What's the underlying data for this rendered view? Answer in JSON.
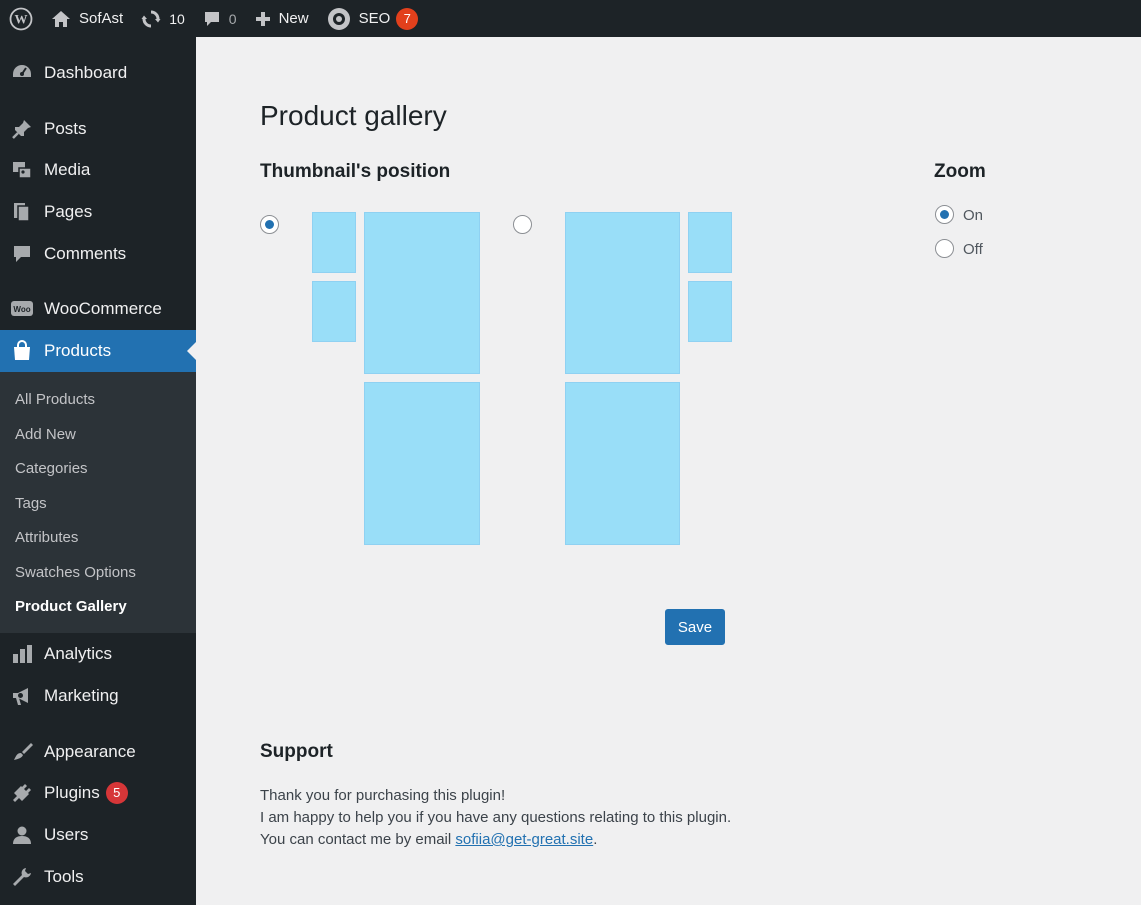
{
  "adminbar": {
    "site_name": "SofAst",
    "updates_count": "10",
    "comments_count": "0",
    "new_label": "New",
    "seo_label": "SEO",
    "seo_badge": "7"
  },
  "sidebar": {
    "items": [
      {
        "label": "Dashboard",
        "icon": "dashboard-icon"
      },
      {
        "label": "Posts",
        "icon": "pin-icon"
      },
      {
        "label": "Media",
        "icon": "media-icon"
      },
      {
        "label": "Pages",
        "icon": "pages-icon"
      },
      {
        "label": "Comments",
        "icon": "comment-icon"
      },
      {
        "label": "WooCommerce",
        "icon": "woo-icon"
      },
      {
        "label": "Products",
        "icon": "bag-icon"
      },
      {
        "label": "Analytics",
        "icon": "bar-chart-icon"
      },
      {
        "label": "Marketing",
        "icon": "megaphone-icon"
      },
      {
        "label": "Appearance",
        "icon": "brush-icon"
      },
      {
        "label": "Plugins",
        "icon": "plug-icon",
        "badge": "5"
      },
      {
        "label": "Users",
        "icon": "user-icon"
      },
      {
        "label": "Tools",
        "icon": "wrench-icon"
      }
    ],
    "submenu": [
      "All Products",
      "Add New",
      "Categories",
      "Tags",
      "Attributes",
      "Swatches Options",
      "Product Gallery"
    ]
  },
  "main": {
    "title": "Product gallery",
    "thumb_heading": "Thumbnail's position",
    "thumb_position_selected": "left",
    "zoom_heading": "Zoom",
    "zoom_options": [
      "On",
      "Off"
    ],
    "zoom_selected": "On",
    "save_label": "Save",
    "support_heading": "Support",
    "support_line1": "Thank you for purchasing this plugin!",
    "support_line2": "I am happy to help you if you have any questions relating to this plugin.",
    "support_line3_prefix": "You can contact me by email ",
    "support_email": "sofiia@get-great.site",
    "support_line3_suffix": "."
  },
  "colors": {
    "accent": "#2271b1",
    "sidebar_bg": "#1d2327",
    "submenu_bg": "#2c3338",
    "preview_box": "#99def8",
    "badge_orange": "#e2401c",
    "badge_red": "#d63638"
  }
}
